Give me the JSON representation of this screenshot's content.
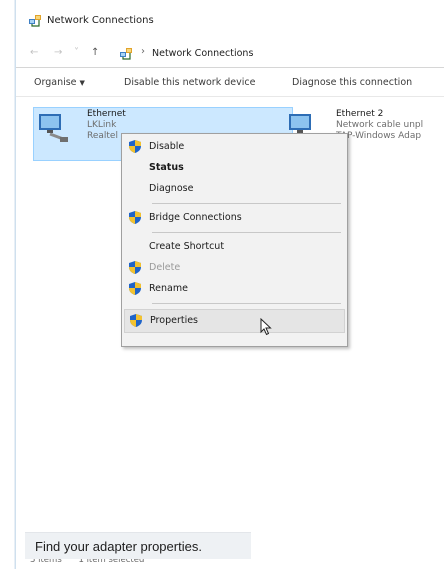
{
  "window": {
    "title": "Network Connections",
    "icon": "network-connections-icon"
  },
  "address_bar": {
    "back": "←",
    "forward": "→",
    "up": "↑",
    "separator": "›",
    "breadcrumb": "Network Connections"
  },
  "command_bar": {
    "organise_label": "Organise",
    "organise_arrow": "▼",
    "disable_label": "Disable this network device",
    "diagnose_label": "Diagnose this connection"
  },
  "adapters": [
    {
      "name": "Ethernet",
      "line2": "LKLink",
      "line3": "Realtel",
      "selected": true
    },
    {
      "name": "Ethernet 2",
      "line2": "Network cable unpl",
      "line3": "TAP-Windows Adap",
      "selected": false
    }
  ],
  "context_menu": {
    "items": [
      {
        "label": "Disable",
        "shield": true,
        "bold": false,
        "disabled": false
      },
      {
        "label": "Status",
        "shield": false,
        "bold": true,
        "disabled": false
      },
      {
        "label": "Diagnose",
        "shield": false,
        "bold": false,
        "disabled": false
      },
      {
        "label": "Bridge Connections",
        "shield": true,
        "bold": false,
        "disabled": false
      },
      {
        "label": "Create Shortcut",
        "shield": false,
        "bold": false,
        "disabled": false
      },
      {
        "label": "Delete",
        "shield": true,
        "bold": false,
        "disabled": true
      },
      {
        "label": "Rename",
        "shield": true,
        "bold": false,
        "disabled": false
      },
      {
        "label": "Properties",
        "shield": true,
        "bold": false,
        "disabled": false,
        "hovered": true
      }
    ]
  },
  "status_bar": {
    "items_count": "3 items",
    "selected_count": "1 item selected"
  },
  "caption": {
    "text": "Find your adapter properties."
  },
  "colors": {
    "selection_bg": "#cce8ff",
    "selection_border": "#99d1ff",
    "menu_bg": "#f2f2f2",
    "caption_bg": "#eef1f4"
  }
}
